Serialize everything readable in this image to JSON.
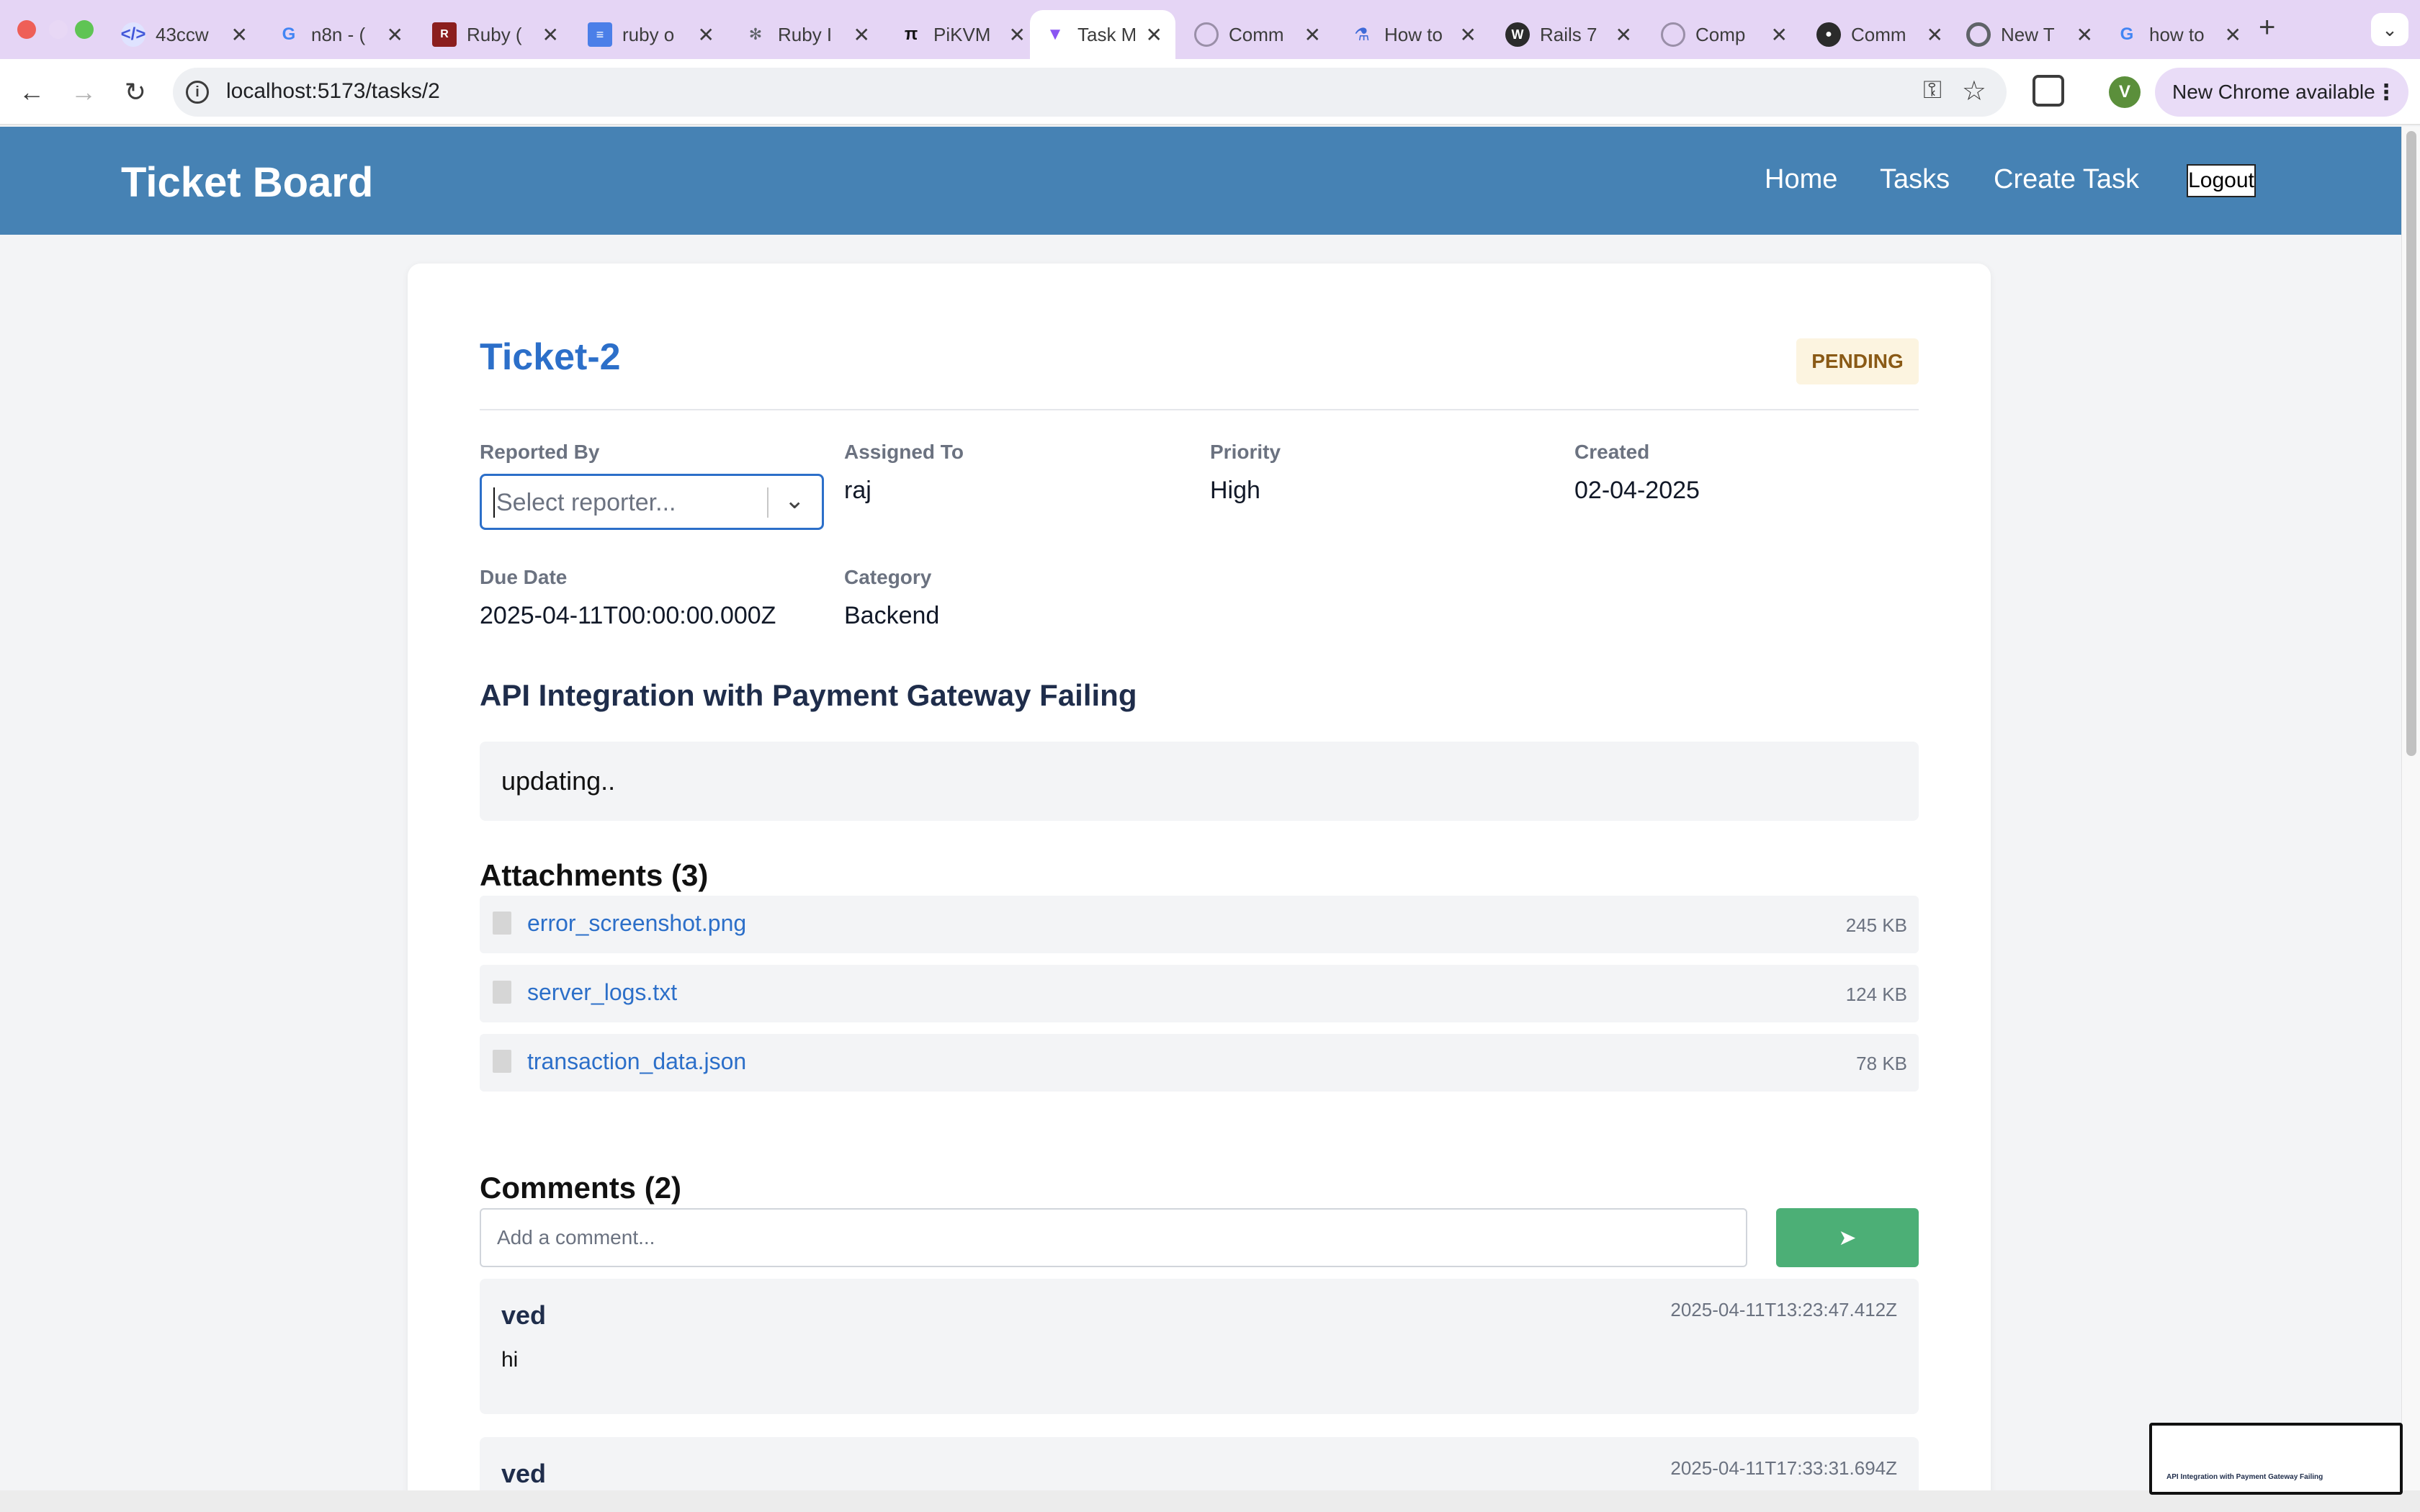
{
  "browser": {
    "tabs": [
      {
        "label": "43ccw",
        "icon": "code-icon"
      },
      {
        "label": "n8n - (",
        "icon": "google-icon"
      },
      {
        "label": "Ruby (",
        "icon": "ruby-icon"
      },
      {
        "label": "ruby o",
        "icon": "docs-icon"
      },
      {
        "label": "Ruby I",
        "icon": "openai-icon"
      },
      {
        "label": "PiKVM",
        "icon": "pi-icon"
      },
      {
        "label": "Task M",
        "icon": "vite-icon"
      },
      {
        "label": "Comm",
        "icon": "circle-icon"
      },
      {
        "label": "How to",
        "icon": "flask-icon"
      },
      {
        "label": "Rails 7",
        "icon": "wordpress-icon"
      },
      {
        "label": "Comp",
        "icon": "circle-icon"
      },
      {
        "label": "Comm",
        "icon": "github-icon"
      },
      {
        "label": "New T",
        "icon": "chrome-icon"
      },
      {
        "label": "how to",
        "icon": "google-icon"
      }
    ],
    "url": "localhost:5173/tasks/2",
    "update_label": "New Chrome available",
    "avatar_letter": "V"
  },
  "app": {
    "brand": "Ticket Board",
    "nav": {
      "home": "Home",
      "tasks": "Tasks",
      "create": "Create Task",
      "logout": "Logout"
    }
  },
  "ticket": {
    "title": "Ticket-2",
    "status": "PENDING",
    "fields": {
      "reported_by": {
        "label": "Reported By",
        "placeholder": "Select reporter..."
      },
      "assigned_to": {
        "label": "Assigned To",
        "value": "raj"
      },
      "priority": {
        "label": "Priority",
        "value": "High"
      },
      "created": {
        "label": "Created",
        "value": "02-04-2025"
      },
      "due_date": {
        "label": "Due Date",
        "value": "2025-04-11T00:00:00.000Z"
      },
      "category": {
        "label": "Category",
        "value": "Backend"
      }
    },
    "subject": "API Integration with Payment Gateway Failing",
    "description": "updating..",
    "attachments_heading": "Attachments (3)",
    "attachments": [
      {
        "name": "error_screenshot.png",
        "size": "245 KB"
      },
      {
        "name": "server_logs.txt",
        "size": "124 KB"
      },
      {
        "name": "transaction_data.json",
        "size": "78 KB"
      }
    ],
    "comments_heading": "Comments (2)",
    "comment_placeholder": "Add a comment...",
    "send_label": "➤",
    "comments": [
      {
        "author": "ved",
        "time": "2025-04-11T13:23:47.412Z",
        "text": "hi"
      },
      {
        "author": "ved",
        "time": "2025-04-11T17:33:31.694Z",
        "text": ""
      }
    ]
  },
  "colors": {
    "header": "#4682b4",
    "accent": "#2c6fc9",
    "send": "#4caf76",
    "status_bg": "#fcf4e0"
  }
}
